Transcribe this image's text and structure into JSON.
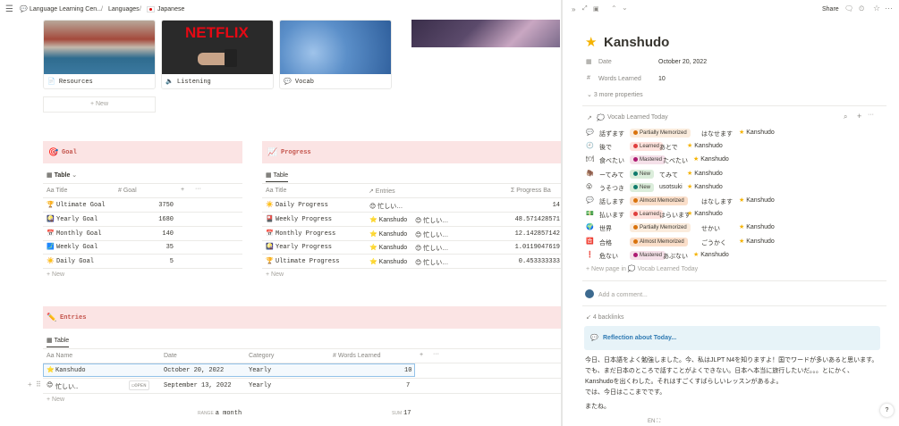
{
  "topbar": {
    "breadcrumb": [
      "Language Learning Cen...",
      "Languages",
      "Japanese"
    ],
    "sep": "/"
  },
  "cards": [
    {
      "label": "Resources",
      "icon": "📄"
    },
    {
      "label": "Listening",
      "icon": "🔈"
    },
    {
      "label": "Vocab",
      "icon": "💬"
    }
  ],
  "netflix_text": "NETFLIX",
  "new_label": "+ New",
  "goal": {
    "title": "Goal",
    "view": "Table",
    "cols": [
      "Aa Title",
      "# Goal"
    ],
    "rows": [
      {
        "icon": "🏆",
        "title": "Ultimate Goal",
        "goal": "3750"
      },
      {
        "icon": "🎑",
        "title": "Yearly Goal",
        "goal": "1680"
      },
      {
        "icon": "📅",
        "title": "Monthly Goal",
        "goal": "140"
      },
      {
        "icon": "🗾",
        "title": "Weekly Goal",
        "goal": "35"
      },
      {
        "icon": "☀️",
        "title": "Daily Goal",
        "goal": "5"
      }
    ]
  },
  "progress": {
    "title": "Progress",
    "view": "Table",
    "cols": [
      "Aa Title",
      "↗ Entries",
      "Σ Progress Ba"
    ],
    "rows": [
      {
        "icon": "☀️",
        "title": "Daily Progress",
        "entries": [
          "😊 忙しい…"
        ],
        "value": "14"
      },
      {
        "icon": "🎴",
        "title": "Weekly Progress",
        "entries": [
          "⭐ Kanshudo",
          "😊 忙しい…"
        ],
        "value": "48.571428571"
      },
      {
        "icon": "📅",
        "title": "Monthly Progress",
        "entries": [
          "⭐ Kanshudo",
          "😊 忙しい…"
        ],
        "value": "12.142857142"
      },
      {
        "icon": "🎑",
        "title": "Yearly Progress",
        "entries": [
          "⭐ Kanshudo",
          "😊 忙しい…"
        ],
        "value": "1.0119047619"
      },
      {
        "icon": "🏆",
        "title": "Ultimate Progress",
        "entries": [
          "⭐ Kanshudo",
          "😊 忙しい…"
        ],
        "value": "0.453333333"
      }
    ]
  },
  "entries": {
    "title": "Entries",
    "view": "Table",
    "cols": [
      "Aa Name",
      "Date",
      "Category",
      "# Words Learned"
    ],
    "rows": [
      {
        "icon": "⭐",
        "name": "Kanshudo",
        "date": "October 20, 2022",
        "category": "Yearly",
        "words": "10"
      },
      {
        "icon": "😊",
        "name": "忙しい…",
        "date": "September 13, 2022",
        "category": "Yearly",
        "words": "7",
        "open": "OPEN"
      }
    ],
    "footer_date_label": "RANGE",
    "footer_date_value": "a month",
    "footer_sum_label": "SUM",
    "footer_sum_value": "17"
  },
  "panel": {
    "share": "Share",
    "title": "Kanshudo",
    "props": [
      {
        "icon": "📅",
        "label": "Date",
        "value": "October 20, 2022"
      },
      {
        "icon": "#",
        "label": "Words Learned",
        "value": "10"
      }
    ],
    "more": "3 more properties",
    "relation_label": "Vocab Learned Today",
    "vocab": [
      {
        "icon": "💬",
        "word": "話ずます",
        "status": "Partially Memorized",
        "reading": "はなせます",
        "ref": "Kanshudo"
      },
      {
        "icon": "🕘",
        "word": "後で",
        "status": "Learned",
        "reading": "あとで",
        "ref": "Kanshudo"
      },
      {
        "icon": "🍽",
        "word": "食べたい",
        "status": "Mastered",
        "reading": "たべたい",
        "ref": "Kanshudo"
      },
      {
        "icon": "🦣",
        "word": "ーてみて",
        "status": "New",
        "reading": "てみて",
        "ref": "Kanshudo"
      },
      {
        "icon": "😮",
        "word": "うそつき",
        "status": "New",
        "reading": "usotsuki",
        "ref": "Kanshudo"
      },
      {
        "icon": "💬",
        "word": "話します",
        "status": "Almost Memorized",
        "reading": "はなします",
        "ref": "Kanshudo"
      },
      {
        "icon": "💵",
        "word": "払います",
        "status": "Learned",
        "reading": "はらいます",
        "ref": "Kanshudo"
      },
      {
        "icon": "🌍",
        "word": "世界",
        "status": "Partially Memorized",
        "reading": "せかい",
        "ref": "Kanshudo"
      },
      {
        "icon": "🈴",
        "word": "合格",
        "status": "Almost Memorized",
        "reading": "ごうかく",
        "ref": "Kanshudo"
      },
      {
        "icon": "❗",
        "word": "危ない",
        "status": "Mastered",
        "reading": "あぶない",
        "ref": "Kanshudo"
      }
    ],
    "new_page": "+ New page in",
    "new_page_target": "Vocab Learned Today",
    "comment_placeholder": "Add a comment...",
    "backlinks": "4 backlinks",
    "callout": "Reflection about Today...",
    "body": [
      "今日、日本語をよく勉強しました。今、私はJLPT N4を知りますよ！国でワードが多いあると思います。でも、まだ日本のところで話すことがよくできない。日本へ本当に旅行したいだ。。。とにかく、Kanshudoを出くわした。それはすごくすばらしいレッスンがあるよ。",
      "では、今日はここまでです。",
      "またね。"
    ],
    "lang": "EN",
    "help": "?"
  },
  "status_colors": {
    "Partially Memorized": {
      "bg": "#fbecdd",
      "dot": "#d9730d"
    },
    "Learned": {
      "bg": "#ffe2dd",
      "dot": "#e03e3e"
    },
    "Mastered": {
      "bg": "#f5e0e9",
      "dot": "#ad1a72"
    },
    "New": {
      "bg": "#dbeddb",
      "dot": "#0f7b6c"
    },
    "Almost Memorized": {
      "bg": "#fadec9",
      "dot": "#d9730d"
    }
  }
}
